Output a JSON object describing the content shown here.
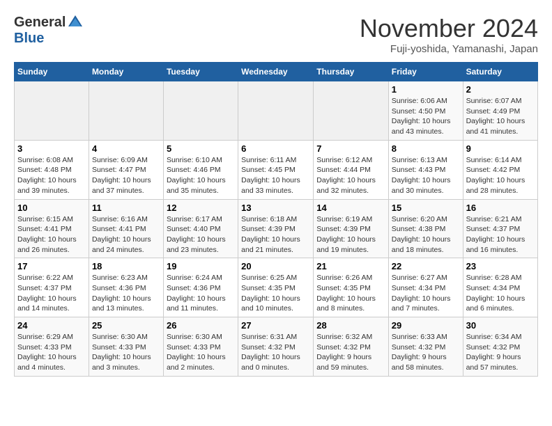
{
  "header": {
    "logo_general": "General",
    "logo_blue": "Blue",
    "title": "November 2024",
    "location": "Fuji-yoshida, Yamanashi, Japan"
  },
  "weekdays": [
    "Sunday",
    "Monday",
    "Tuesday",
    "Wednesday",
    "Thursday",
    "Friday",
    "Saturday"
  ],
  "weeks": [
    [
      {
        "day": "",
        "info": ""
      },
      {
        "day": "",
        "info": ""
      },
      {
        "day": "",
        "info": ""
      },
      {
        "day": "",
        "info": ""
      },
      {
        "day": "",
        "info": ""
      },
      {
        "day": "1",
        "info": "Sunrise: 6:06 AM\nSunset: 4:50 PM\nDaylight: 10 hours\nand 43 minutes."
      },
      {
        "day": "2",
        "info": "Sunrise: 6:07 AM\nSunset: 4:49 PM\nDaylight: 10 hours\nand 41 minutes."
      }
    ],
    [
      {
        "day": "3",
        "info": "Sunrise: 6:08 AM\nSunset: 4:48 PM\nDaylight: 10 hours\nand 39 minutes."
      },
      {
        "day": "4",
        "info": "Sunrise: 6:09 AM\nSunset: 4:47 PM\nDaylight: 10 hours\nand 37 minutes."
      },
      {
        "day": "5",
        "info": "Sunrise: 6:10 AM\nSunset: 4:46 PM\nDaylight: 10 hours\nand 35 minutes."
      },
      {
        "day": "6",
        "info": "Sunrise: 6:11 AM\nSunset: 4:45 PM\nDaylight: 10 hours\nand 33 minutes."
      },
      {
        "day": "7",
        "info": "Sunrise: 6:12 AM\nSunset: 4:44 PM\nDaylight: 10 hours\nand 32 minutes."
      },
      {
        "day": "8",
        "info": "Sunrise: 6:13 AM\nSunset: 4:43 PM\nDaylight: 10 hours\nand 30 minutes."
      },
      {
        "day": "9",
        "info": "Sunrise: 6:14 AM\nSunset: 4:42 PM\nDaylight: 10 hours\nand 28 minutes."
      }
    ],
    [
      {
        "day": "10",
        "info": "Sunrise: 6:15 AM\nSunset: 4:41 PM\nDaylight: 10 hours\nand 26 minutes."
      },
      {
        "day": "11",
        "info": "Sunrise: 6:16 AM\nSunset: 4:41 PM\nDaylight: 10 hours\nand 24 minutes."
      },
      {
        "day": "12",
        "info": "Sunrise: 6:17 AM\nSunset: 4:40 PM\nDaylight: 10 hours\nand 23 minutes."
      },
      {
        "day": "13",
        "info": "Sunrise: 6:18 AM\nSunset: 4:39 PM\nDaylight: 10 hours\nand 21 minutes."
      },
      {
        "day": "14",
        "info": "Sunrise: 6:19 AM\nSunset: 4:39 PM\nDaylight: 10 hours\nand 19 minutes."
      },
      {
        "day": "15",
        "info": "Sunrise: 6:20 AM\nSunset: 4:38 PM\nDaylight: 10 hours\nand 18 minutes."
      },
      {
        "day": "16",
        "info": "Sunrise: 6:21 AM\nSunset: 4:37 PM\nDaylight: 10 hours\nand 16 minutes."
      }
    ],
    [
      {
        "day": "17",
        "info": "Sunrise: 6:22 AM\nSunset: 4:37 PM\nDaylight: 10 hours\nand 14 minutes."
      },
      {
        "day": "18",
        "info": "Sunrise: 6:23 AM\nSunset: 4:36 PM\nDaylight: 10 hours\nand 13 minutes."
      },
      {
        "day": "19",
        "info": "Sunrise: 6:24 AM\nSunset: 4:36 PM\nDaylight: 10 hours\nand 11 minutes."
      },
      {
        "day": "20",
        "info": "Sunrise: 6:25 AM\nSunset: 4:35 PM\nDaylight: 10 hours\nand 10 minutes."
      },
      {
        "day": "21",
        "info": "Sunrise: 6:26 AM\nSunset: 4:35 PM\nDaylight: 10 hours\nand 8 minutes."
      },
      {
        "day": "22",
        "info": "Sunrise: 6:27 AM\nSunset: 4:34 PM\nDaylight: 10 hours\nand 7 minutes."
      },
      {
        "day": "23",
        "info": "Sunrise: 6:28 AM\nSunset: 4:34 PM\nDaylight: 10 hours\nand 6 minutes."
      }
    ],
    [
      {
        "day": "24",
        "info": "Sunrise: 6:29 AM\nSunset: 4:33 PM\nDaylight: 10 hours\nand 4 minutes."
      },
      {
        "day": "25",
        "info": "Sunrise: 6:30 AM\nSunset: 4:33 PM\nDaylight: 10 hours\nand 3 minutes."
      },
      {
        "day": "26",
        "info": "Sunrise: 6:30 AM\nSunset: 4:33 PM\nDaylight: 10 hours\nand 2 minutes."
      },
      {
        "day": "27",
        "info": "Sunrise: 6:31 AM\nSunset: 4:32 PM\nDaylight: 10 hours\nand 0 minutes."
      },
      {
        "day": "28",
        "info": "Sunrise: 6:32 AM\nSunset: 4:32 PM\nDaylight: 9 hours\nand 59 minutes."
      },
      {
        "day": "29",
        "info": "Sunrise: 6:33 AM\nSunset: 4:32 PM\nDaylight: 9 hours\nand 58 minutes."
      },
      {
        "day": "30",
        "info": "Sunrise: 6:34 AM\nSunset: 4:32 PM\nDaylight: 9 hours\nand 57 minutes."
      }
    ]
  ]
}
